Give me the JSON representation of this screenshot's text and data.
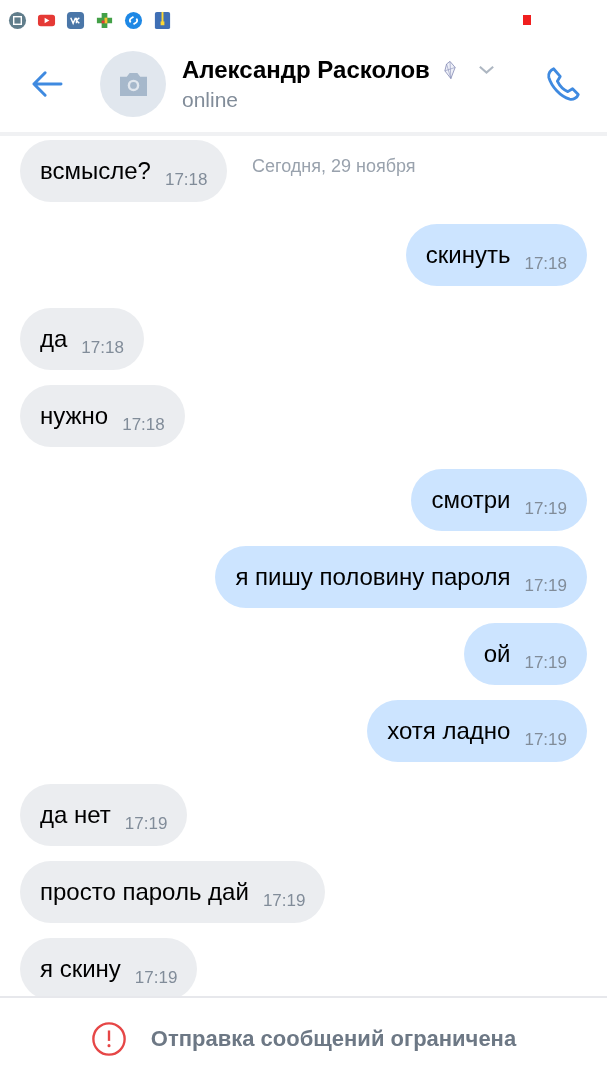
{
  "header": {
    "name": "Александр Расколов",
    "status": "online"
  },
  "date_label": "Сегодня, 29 ноября",
  "messages": [
    {
      "kind": "in",
      "text": "всмысле?",
      "time": "17:18"
    },
    {
      "kind": "out",
      "text": "скинуть",
      "time": "17:18"
    },
    {
      "kind": "in",
      "text": "да",
      "time": "17:18"
    },
    {
      "kind": "in",
      "text": "нужно",
      "time": "17:18"
    },
    {
      "kind": "out",
      "text": "смотри",
      "time": "17:19"
    },
    {
      "kind": "out",
      "text": "я пишу половину пароля",
      "time": "17:19"
    },
    {
      "kind": "out",
      "text": "ой",
      "time": "17:19"
    },
    {
      "kind": "out",
      "text": "хотя ладно",
      "time": "17:19"
    },
    {
      "kind": "in",
      "text": "да нет",
      "time": "17:19"
    },
    {
      "kind": "in",
      "text": "просто пароль дай",
      "time": "17:19"
    },
    {
      "kind": "in",
      "text": "я скину",
      "time": "17:19"
    }
  ],
  "notice": "Отправка сообщений ограничена"
}
